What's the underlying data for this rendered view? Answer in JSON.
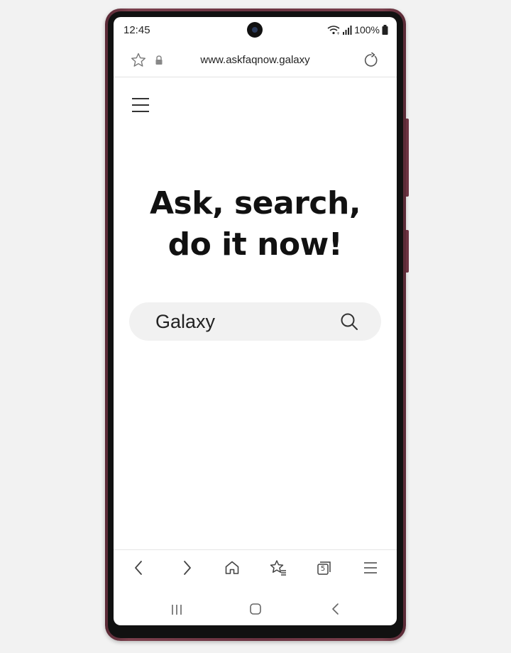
{
  "status_bar": {
    "time": "12:45",
    "battery": "100%"
  },
  "browser": {
    "url": "www.askfaqnow.galaxy"
  },
  "page": {
    "headline_line1": "Ask, search,",
    "headline_line2": "do it now!",
    "search": {
      "value": "Galaxy"
    }
  },
  "toolbar": {
    "tab_count": "5"
  },
  "icons": {
    "status": [
      "wifi-icon",
      "signal-icon",
      "battery-icon"
    ],
    "url_bar": [
      "bookmark-star-icon",
      "lock-icon",
      "reload-icon"
    ],
    "page": [
      "hamburger-menu-icon",
      "search-icon"
    ],
    "toolbar": [
      "back-icon",
      "forward-icon",
      "home-icon",
      "bookmarks-icon",
      "tabs-icon",
      "menu-icon"
    ],
    "navbar": [
      "recents-icon",
      "home-nav-icon",
      "back-nav-icon"
    ]
  },
  "colors": {
    "phone_frame": "#6b3341",
    "background": "#f2f2f2",
    "search_box": "#f1f1f1"
  }
}
